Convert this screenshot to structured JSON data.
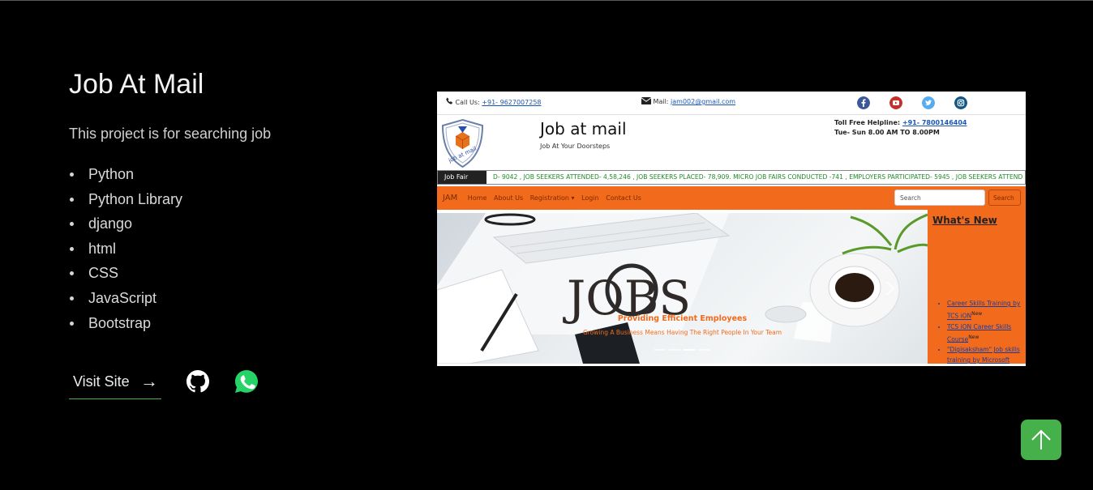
{
  "project": {
    "title": "Job At Mail",
    "description": "This project is for searching job",
    "tech": [
      "Python",
      "Python Library",
      "django",
      "html",
      "CSS",
      "JavaScript",
      "Bootstrap"
    ],
    "visit_label": "Visit Site",
    "visit_arrow": "→"
  },
  "screenshot": {
    "call_label": "Call Us:",
    "call_number": "+91- 9627007258",
    "mail_label": "Mail:",
    "mail_address": "jam002@gmail.com",
    "brand": "Job at mail",
    "tagline": "Job At Your Doorsteps",
    "toll_label": "Toll Free Helpline:",
    "toll_number": "+91- 7800146404",
    "toll_hours": "Tue- Sun 8.00 AM TO 8.00PM",
    "ticker_label": "Job Fair",
    "ticker_text": "D- 9042 , JOB SEEKERS ATTENDED- 4,58,246 , JOB SEEKERS PLACED- 78,909. MICRO JOB FAIRS CONDUCTED -741 , EMPLOYERS PARTICIPATED- 5945 , JOB SEEKERS ATTEND",
    "nav": {
      "brand": "JAM",
      "items": [
        "Home",
        "About Us",
        "Registration ▾",
        "Login",
        "Contact Us"
      ],
      "search_placeholder": "Search",
      "search_button": "Search"
    },
    "hero_word": "JOBS",
    "hero_caption": "Providing Efficient Employees",
    "hero_sub": "Growing A Business Means Having The Right People In Your Team",
    "whats_new_title": "What's New",
    "whats_new_items": [
      {
        "text": "Career Skills Training by TCS iON",
        "badge": "New"
      },
      {
        "text": "TCS iON Career Skills Course",
        "badge": "New"
      },
      {
        "text": "\"Digisaksham\" Job skills training by Microsoft",
        "badge": ""
      }
    ]
  },
  "colors": {
    "accent": "#4caf50",
    "site_orange": "#f26a1b",
    "background": "#000000"
  },
  "icons": [
    "github-icon",
    "whatsapp-icon",
    "arrow-up-icon",
    "phone-icon",
    "mail-icon",
    "facebook-icon",
    "youtube-icon",
    "twitter-icon",
    "instagram-icon"
  ]
}
